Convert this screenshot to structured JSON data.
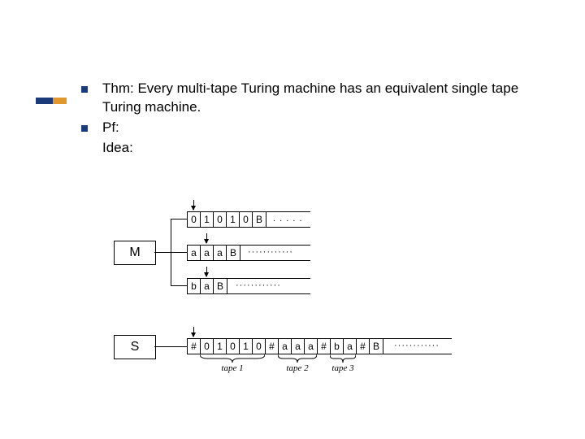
{
  "bullets": {
    "thm": "Thm: Every multi-tape Turing machine has an equivalent single tape Turing machine.",
    "pf": "Pf:",
    "idea": "Idea:"
  },
  "boxes": {
    "M": "M",
    "S": "S"
  },
  "tapes": {
    "t1": [
      "0",
      "1",
      "0",
      "1",
      "0",
      "B"
    ],
    "t2": [
      "a",
      "a",
      "a",
      "B"
    ],
    "t3": [
      "b",
      "a",
      "B"
    ]
  },
  "single": [
    "#",
    "0",
    "1",
    "0",
    "1",
    "0",
    "#",
    "a",
    "a",
    "a",
    "#",
    "b",
    "a",
    "#",
    "B"
  ],
  "dots": {
    "d1": ". . . . .",
    "d2": "············",
    "d3": "············",
    "d4": "············"
  },
  "labels": {
    "tape1": "tape 1",
    "tape2": "tape 2",
    "tape3": "tape 3"
  }
}
